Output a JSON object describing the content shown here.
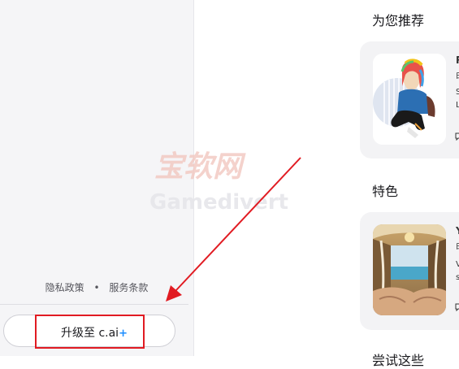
{
  "sidebar": {
    "footer": {
      "privacy": "隐私政策",
      "separator": "•",
      "terms": "服务条款"
    },
    "upgrade": {
      "label": "升级至 c.ai",
      "plus": "+"
    }
  },
  "main": {
    "sections": [
      {
        "title": "为您推荐",
        "card": {
          "name_initial": "R",
          "line2": "由",
          "line3": "S",
          "line4": "L",
          "icon": "chat-bubble-icon"
        }
      },
      {
        "title": "特色",
        "card": {
          "name_initial": "Y",
          "line2": "由",
          "line3": "V",
          "line4": "s",
          "icon": "chat-bubble-icon"
        }
      },
      {
        "title": "尝试这些"
      }
    ]
  },
  "watermark": {
    "text_top": "宝软网",
    "text_bottom": "Gamedivert"
  },
  "colors": {
    "highlight": "#e11b22",
    "accent_plus": "#1a8cff",
    "sidebar_bg": "#f5f5f7",
    "card_bg": "#f3f3f5"
  }
}
